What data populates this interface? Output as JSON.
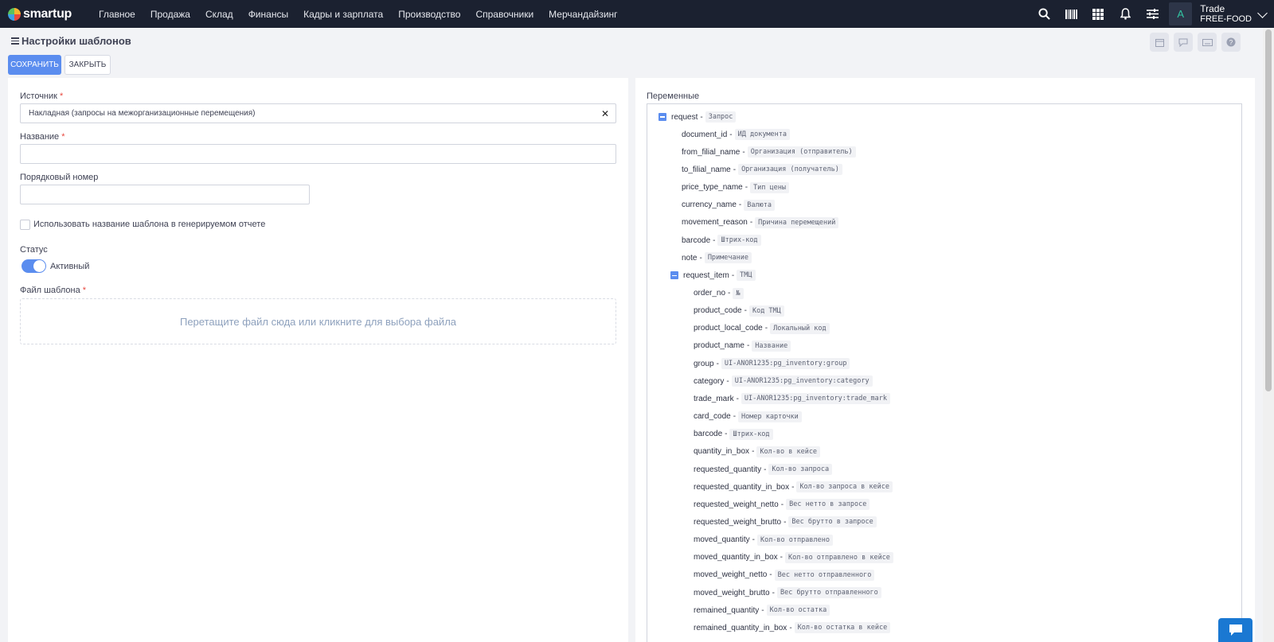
{
  "app": {
    "logo_text": "smartup"
  },
  "nav": [
    "Главное",
    "Продажа",
    "Склад",
    "Финансы",
    "Кадры и зарплата",
    "Производство",
    "Справочники",
    "Мерчандайзинг"
  ],
  "top_icons": [
    "search-icon",
    "barcode-icon",
    "grid-icon",
    "bell-icon",
    "sliders-icon"
  ],
  "user": {
    "avatar_letter": "A",
    "name": "Trade",
    "company": "FREE-FOOD"
  },
  "page": {
    "title": "Настройки шаблонов"
  },
  "toolbar": {
    "save_label": "СОХРАНИТЬ",
    "close_label": "ЗАКРЫТЬ"
  },
  "form": {
    "source_label": "Источник",
    "source_value": "Накладная (запросы на межорганизационные перемещения)",
    "name_label": "Название",
    "name_value": "",
    "order_label": "Порядковый номер",
    "order_value": "",
    "use_name_label": "Использовать название шаблона в генерируемом отчете",
    "use_name_checked": false,
    "status_label": "Статус",
    "status_value": "Активный",
    "status_on": true,
    "file_label": "Файл шаблона",
    "dropzone_text": "Перетащите файл сюда или кликните для выбора файла",
    "required_mark": "*"
  },
  "variables": {
    "title": "Переменные",
    "items": [
      {
        "key": "request",
        "desc": "Запрос",
        "level": 0,
        "group": true
      },
      {
        "key": "document_id",
        "desc": "ИД документа",
        "level": 1
      },
      {
        "key": "from_filial_name",
        "desc": "Организация (отправитель)",
        "level": 1
      },
      {
        "key": "to_filial_name",
        "desc": "Организация (получатель)",
        "level": 1
      },
      {
        "key": "price_type_name",
        "desc": "Тип цены",
        "level": 1
      },
      {
        "key": "currency_name",
        "desc": "Валюта",
        "level": 1
      },
      {
        "key": "movement_reason",
        "desc": "Причина перемещений",
        "level": 1
      },
      {
        "key": "barcode",
        "desc": "Штрих-код",
        "level": 1
      },
      {
        "key": "note",
        "desc": "Примечание",
        "level": 1
      },
      {
        "key": "request_item",
        "desc": "ТМЦ",
        "level": 1,
        "group": true
      },
      {
        "key": "order_no",
        "desc": "№",
        "level": 2
      },
      {
        "key": "product_code",
        "desc": "Код ТМЦ",
        "level": 2
      },
      {
        "key": "product_local_code",
        "desc": "Локальный код",
        "level": 2
      },
      {
        "key": "product_name",
        "desc": "Название",
        "level": 2
      },
      {
        "key": "group",
        "desc": "UI-ANOR1235:pg_inventory:group",
        "level": 2
      },
      {
        "key": "category",
        "desc": "UI-ANOR1235:pg_inventory:category",
        "level": 2
      },
      {
        "key": "trade_mark",
        "desc": "UI-ANOR1235:pg_inventory:trade_mark",
        "level": 2
      },
      {
        "key": "card_code",
        "desc": "Номер карточки",
        "level": 2
      },
      {
        "key": "barcode",
        "desc": "Штрих-код",
        "level": 2
      },
      {
        "key": "quantity_in_box",
        "desc": "Кол-во в кейсе",
        "level": 2
      },
      {
        "key": "requested_quantity",
        "desc": "Кол-во запроса",
        "level": 2
      },
      {
        "key": "requested_quantity_in_box",
        "desc": "Кол-во запроса в кейсе",
        "level": 2
      },
      {
        "key": "requested_weight_netto",
        "desc": "Вес нетто в запросе",
        "level": 2
      },
      {
        "key": "requested_weight_brutto",
        "desc": "Вес брутто в запросе",
        "level": 2
      },
      {
        "key": "moved_quantity",
        "desc": "Кол-во отправлено",
        "level": 2
      },
      {
        "key": "moved_quantity_in_box",
        "desc": "Кол-во отправлено в кейсе",
        "level": 2
      },
      {
        "key": "moved_weight_netto",
        "desc": "Вес нетто отправленного",
        "level": 2
      },
      {
        "key": "moved_weight_brutto",
        "desc": "Вес брутто отправленного",
        "level": 2
      },
      {
        "key": "remained_quantity",
        "desc": "Кол-во остатка",
        "level": 2
      },
      {
        "key": "remained_quantity_in_box",
        "desc": "Кол-во остатка в кейсе",
        "level": 2
      }
    ]
  },
  "colors": {
    "topbar": "#1b2130",
    "accent": "#5b8def",
    "required": "#e8483f"
  }
}
